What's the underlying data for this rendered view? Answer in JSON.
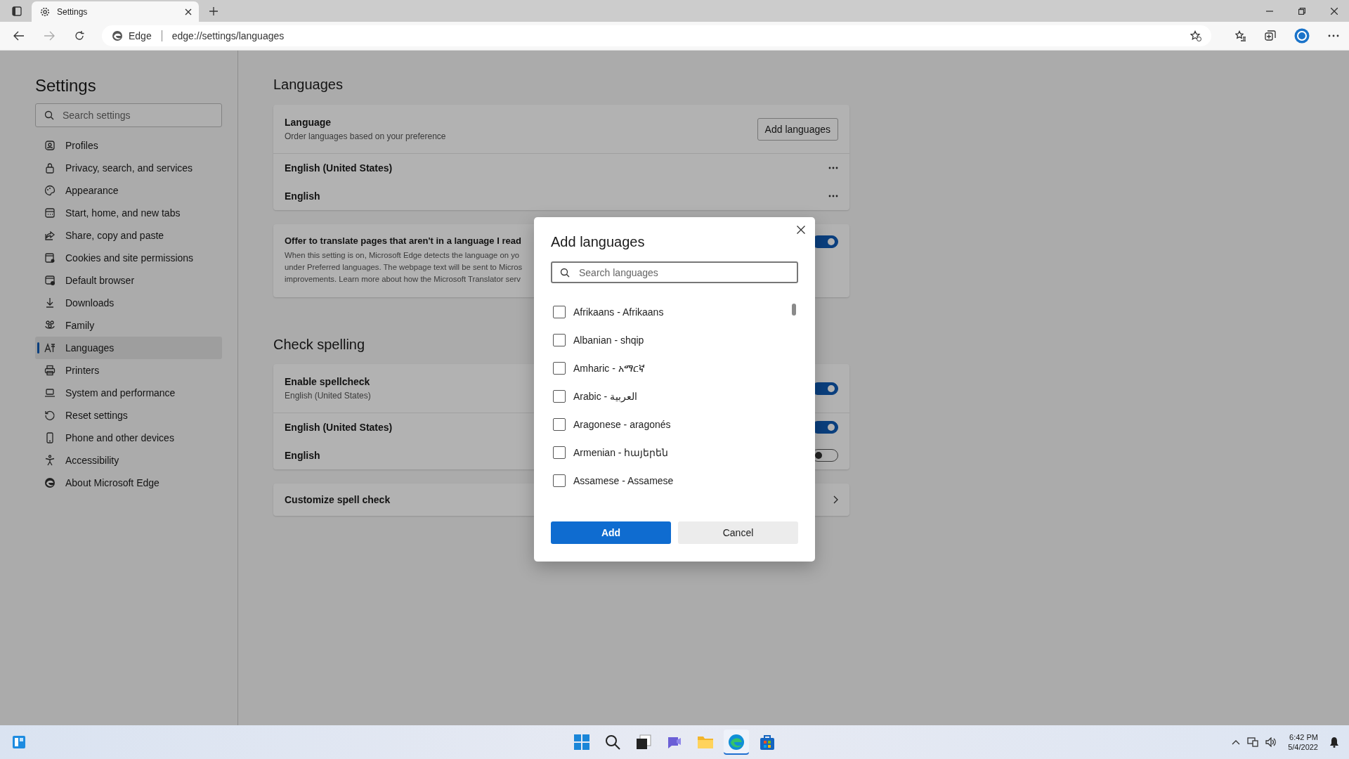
{
  "browser": {
    "tab": {
      "title": "Settings",
      "selected": true
    },
    "address": {
      "site_label": "Edge",
      "url": "edge://settings/languages"
    }
  },
  "sidebar": {
    "title": "Settings",
    "search": {
      "placeholder": "Search settings"
    },
    "items": [
      {
        "label": "Profiles",
        "selected": false
      },
      {
        "label": "Privacy, search, and services",
        "selected": false
      },
      {
        "label": "Appearance",
        "selected": false
      },
      {
        "label": "Start, home, and new tabs",
        "selected": false
      },
      {
        "label": "Share, copy and paste",
        "selected": false
      },
      {
        "label": "Cookies and site permissions",
        "selected": false
      },
      {
        "label": "Default browser",
        "selected": false
      },
      {
        "label": "Downloads",
        "selected": false
      },
      {
        "label": "Family",
        "selected": false
      },
      {
        "label": "Languages",
        "selected": true
      },
      {
        "label": "Printers",
        "selected": false
      },
      {
        "label": "System and performance",
        "selected": false
      },
      {
        "label": "Reset settings",
        "selected": false
      },
      {
        "label": "Phone and other devices",
        "selected": false
      },
      {
        "label": "Accessibility",
        "selected": false
      },
      {
        "label": "About Microsoft Edge",
        "selected": false
      }
    ]
  },
  "languages": {
    "heading": "Languages",
    "title": "Language",
    "subtitle": "Order languages based on your preference",
    "button": "Add languages",
    "preferred": [
      {
        "label": "English (United States)"
      },
      {
        "label": "English"
      }
    ]
  },
  "translate": {
    "title": "Offer to translate pages that aren't in a language I read",
    "description_lines": [
      "When this setting is on, Microsoft Edge detects the language on yo",
      "under Preferred languages. The webpage text will be sent to Micros",
      "improvements. Learn more about how the Microsoft Translator serv"
    ],
    "on": true
  },
  "spelling": {
    "heading": "Check spelling",
    "enable": {
      "title": "Enable spellcheck",
      "subtitle": "English (United States)",
      "on": true
    },
    "languages": [
      {
        "label": "English (United States)",
        "on": true
      },
      {
        "label": "English",
        "on": false
      }
    ],
    "customize": "Customize spell check"
  },
  "dialog": {
    "title": "Add languages",
    "search": {
      "placeholder": "Search languages"
    },
    "options": [
      {
        "label": "Afrikaans - Afrikaans",
        "checked": false
      },
      {
        "label": "Albanian - shqip",
        "checked": false
      },
      {
        "label": "Amharic - አማርኛ",
        "checked": false
      },
      {
        "label": "Arabic - العربية",
        "checked": false
      },
      {
        "label": "Aragonese - aragonés",
        "checked": false
      },
      {
        "label": "Armenian - հայերեն",
        "checked": false
      },
      {
        "label": "Assamese - Assamese",
        "checked": false
      }
    ],
    "add": "Add",
    "cancel": "Cancel"
  },
  "taskbar": {
    "time": "6:42 PM",
    "date": "5/4/2022"
  }
}
